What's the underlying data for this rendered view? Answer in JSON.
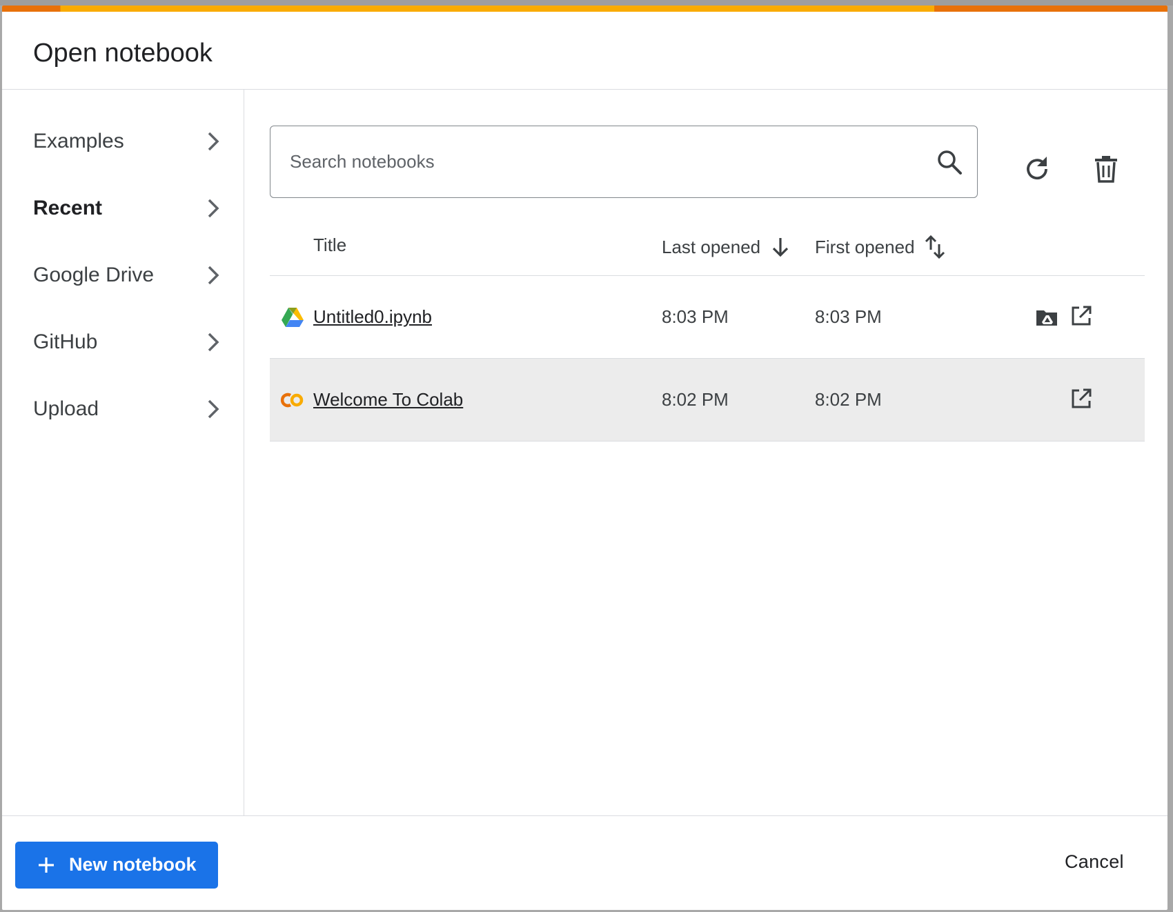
{
  "dialog": {
    "title": "Open notebook",
    "accent_colors": [
      "#e8710a",
      "#f9ab00"
    ]
  },
  "sidebar": {
    "items": [
      {
        "label": "Examples",
        "active": false
      },
      {
        "label": "Recent",
        "active": true
      },
      {
        "label": "Google Drive",
        "active": false
      },
      {
        "label": "GitHub",
        "active": false
      },
      {
        "label": "Upload",
        "active": false
      }
    ]
  },
  "search": {
    "placeholder": "Search notebooks",
    "value": ""
  },
  "toolbar": {
    "refresh_icon": "refresh-icon",
    "delete_icon": "trash-icon"
  },
  "table": {
    "columns": [
      {
        "label": "Title"
      },
      {
        "label": "Last opened",
        "sort": "descending"
      },
      {
        "label": "First opened",
        "sort": "unsorted"
      }
    ],
    "rows": [
      {
        "icon": "google-drive-icon",
        "title": "Untitled0.ipynb",
        "last_opened": "8:03 PM",
        "first_opened": "8:03 PM",
        "has_drive_folder": true
      },
      {
        "icon": "colab-icon",
        "title": "Welcome To Colab",
        "last_opened": "8:02 PM",
        "first_opened": "8:02 PM",
        "has_drive_folder": false
      }
    ]
  },
  "footer": {
    "new_notebook_label": "New notebook",
    "cancel_label": "Cancel",
    "primary_color": "#1a73e8"
  }
}
